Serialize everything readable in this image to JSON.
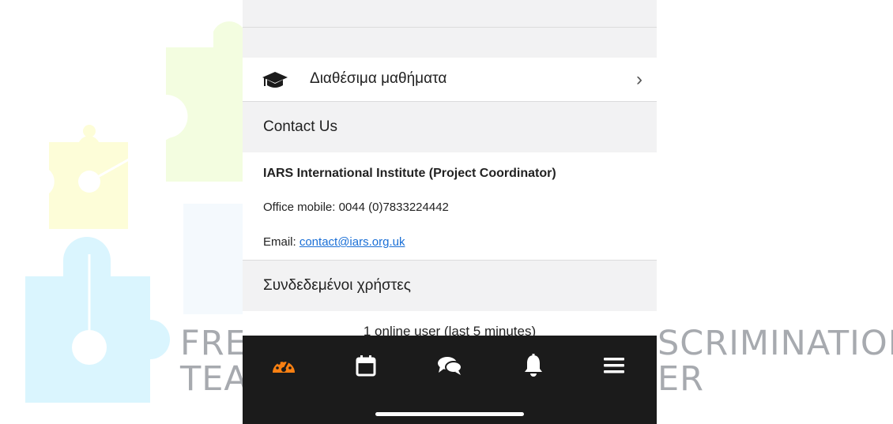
{
  "watermark": {
    "left_line1": "FRE",
    "left_line2": "TEA",
    "right_line1": "SCRIMINATION:",
    "right_line2": "ER"
  },
  "menu": {
    "courses_label": "Διαθέσιμα μαθήματα",
    "courses_icon": "graduation-cap-icon"
  },
  "contact": {
    "heading": "Contact Us",
    "org": "IARS International Institute (Project Coordinator)",
    "phone_line": "Office mobile: 0044 (0)7833224442",
    "email_prefix": "Email: ",
    "email": "contact@iars.org.uk"
  },
  "online_users": {
    "heading": "Συνδεδεμένοι χρήστες",
    "text": "1 online user (last 5 minutes)"
  },
  "tabbar": {
    "tabs": [
      {
        "icon": "dashboard-icon",
        "active": true
      },
      {
        "icon": "calendar-icon",
        "active": false
      },
      {
        "icon": "messages-icon",
        "active": false
      },
      {
        "icon": "bell-icon",
        "active": false
      },
      {
        "icon": "menu-icon",
        "active": false
      }
    ],
    "active_color": "#f98012",
    "icon_color": "#ffffff"
  },
  "colors": {
    "link": "#1a6fd6",
    "section_bg": "#f2f2f3",
    "tabbar_bg": "#1b1b1b"
  }
}
